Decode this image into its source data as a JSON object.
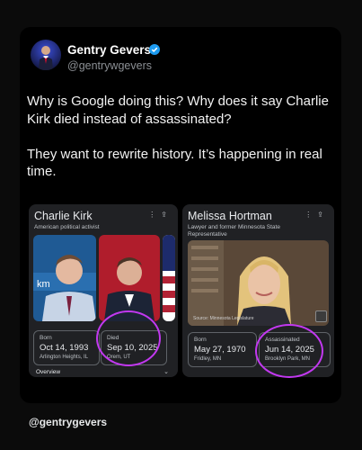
{
  "post": {
    "author_name": "Gentry Gevers",
    "handle": "@gentrywgevers",
    "text": "Why is Google doing this? Why does it say Charlie Kirk died instead of assassinated?\n\nThey want to rewrite history. It’s happening in real time."
  },
  "left_panel": {
    "title": "Charlie Kirk",
    "subtitle": "American political activist",
    "photo_text": "km",
    "born": {
      "label": "Born",
      "value": "Oct 14, 1993",
      "place": "Arlington Heights, IL"
    },
    "died": {
      "label": "Died",
      "value": "Sep 10, 2025",
      "place": "Orem, UT"
    },
    "overview": "Overview"
  },
  "right_panel": {
    "title": "Melissa Hortman",
    "subtitle": "Lawyer and former Minnesota State Representative",
    "photo_credit": "Source: Minnesota Legislature",
    "born": {
      "label": "Born",
      "value": "May 27, 1970",
      "place": "Fridley, MN"
    },
    "assassinated": {
      "label": "Assassinated",
      "value": "Jun 14, 2025",
      "place": "Brooklyn Park, MN"
    }
  },
  "footer": {
    "handle": "@gentrygevers"
  },
  "colors": {
    "highlight_ring": "#c238f0",
    "verified": "#1d9bf0",
    "card_bg": "#202124"
  },
  "icons": [
    "verified-badge-icon",
    "more-vert-icon",
    "share-icon",
    "gallery-icon",
    "chevron-down-icon"
  ]
}
